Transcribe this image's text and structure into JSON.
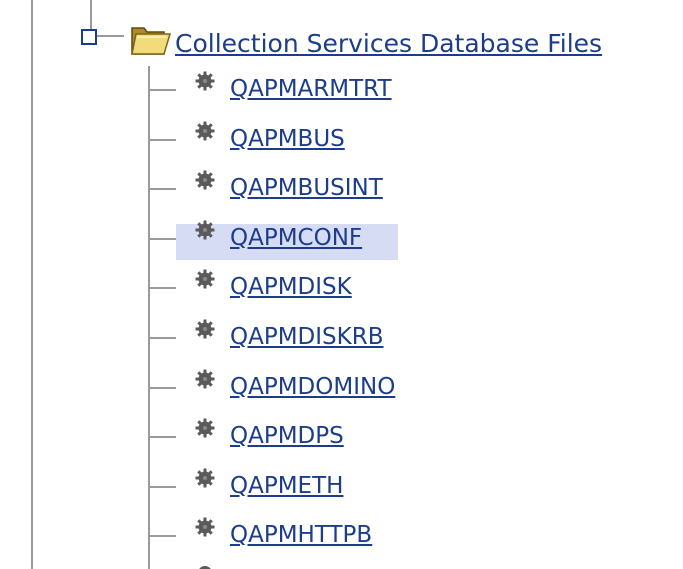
{
  "tree": {
    "folder": {
      "label": "Collection Services Database Files",
      "icon": "open-folder-icon",
      "toggle_icon": "collapse-box-icon",
      "expanded": true
    },
    "items": [
      {
        "label": "QAPMARMTRT",
        "icon": "gear-icon",
        "selected": false
      },
      {
        "label": "QAPMBUS",
        "icon": "gear-icon",
        "selected": false
      },
      {
        "label": "QAPMBUSINT",
        "icon": "gear-icon",
        "selected": false
      },
      {
        "label": "QAPMCONF",
        "icon": "gear-icon",
        "selected": true
      },
      {
        "label": "QAPMDISK",
        "icon": "gear-icon",
        "selected": false
      },
      {
        "label": "QAPMDISKRB",
        "icon": "gear-icon",
        "selected": false
      },
      {
        "label": "QAPMDOMINO",
        "icon": "gear-icon",
        "selected": false
      },
      {
        "label": "QAPMDPS",
        "icon": "gear-icon",
        "selected": false
      },
      {
        "label": "QAPMETH",
        "icon": "gear-icon",
        "selected": false
      },
      {
        "label": "QAPMHTTPB",
        "icon": "gear-icon",
        "selected": false
      }
    ]
  },
  "colors": {
    "link": "#1c3d8c",
    "selected_background": "#d6dcf4",
    "tree_lines": "#9a9a9a",
    "gear": "#5a5a5a"
  }
}
